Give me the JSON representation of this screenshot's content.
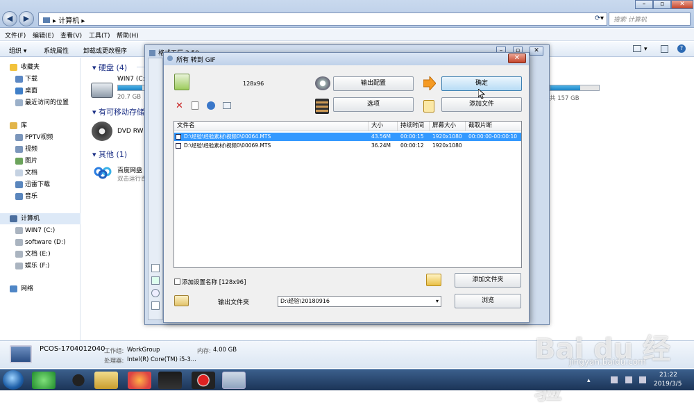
{
  "explorer": {
    "breadcrumb": "计算机",
    "search_placeholder": "搜索 计算机",
    "menu": [
      "文件(F)",
      "编辑(E)",
      "查看(V)",
      "工具(T)",
      "帮助(H)"
    ],
    "commands": [
      "组织",
      "系统属性",
      "卸载或更改程序"
    ],
    "nav": {
      "favorites": "收藏夹",
      "fav_items": [
        "下载",
        "桌面",
        "最近访问的位置"
      ],
      "libraries": "库",
      "lib_items": [
        "PPTV视频",
        "视频",
        "图片",
        "文档",
        "迅雷下载",
        "音乐"
      ],
      "computer": "计算机",
      "drives": [
        "WIN7 (C:)",
        "software (D:)",
        "文档 (E:)",
        "娱乐 (F:)"
      ],
      "network": "网络"
    },
    "groups": {
      "hard_disks": "硬盘 (4)",
      "removable": "有可移动存储的",
      "other": "其他 (1)"
    },
    "drive_c": {
      "name": "WIN7 (C:",
      "free": "20.7 GB",
      "fill_fraction": 0.93
    },
    "drive_right": {
      "free": "共 157 GB",
      "fill_fraction": 0.62
    },
    "dvd": "DVD RW",
    "baidu": {
      "name": "百度网盘",
      "sub": "双击运行百"
    },
    "details": {
      "pc_name": "PCOS-1704012040",
      "workgroup_label": "工作组:",
      "workgroup": "WorkGroup",
      "memory_label": "内存:",
      "memory": "4.00 GB",
      "cpu_label": "处理器:",
      "cpu": "Intel(R) Core(TM) i5-3..."
    }
  },
  "ff_window": {
    "title": "格式工厂 2.50"
  },
  "dialog": {
    "title": "所有 转到 GIF",
    "size_label": "128x96",
    "buttons": {
      "output_config": "输出配置",
      "options": "选项",
      "ok": "确定",
      "add_file": "添加文件",
      "add_folder": "添加文件夹",
      "browse": "浏览"
    },
    "columns": [
      "文件名",
      "大小",
      "持续时间",
      "屏幕大小",
      "截取片断"
    ],
    "rows": [
      {
        "file": "D:\\经验\\经验素材\\视频0\\00064.MTS",
        "size": "43.56M",
        "duration": "00:00:15",
        "screen": "1920x1080",
        "clip": "00:00:00-00:00:10"
      },
      {
        "file": "D:\\经验\\经验素材\\视频0\\00069.MTS",
        "size": "36.24M",
        "duration": "00:00:12",
        "screen": "1920x1080",
        "clip": ""
      }
    ],
    "add_setting_name": "添加设置名称 [128x96]",
    "output_folder_label": "输出文件夹",
    "output_folder": "D:\\经验\\20180916"
  },
  "taskbar": {
    "time": "21:22",
    "date": "2019/3/5"
  },
  "watermark": {
    "brand": "Bai du 经验",
    "url": "jingyan.baidu.com"
  },
  "colors": {
    "selection": "#3399ff",
    "accent": "#1e3287"
  }
}
